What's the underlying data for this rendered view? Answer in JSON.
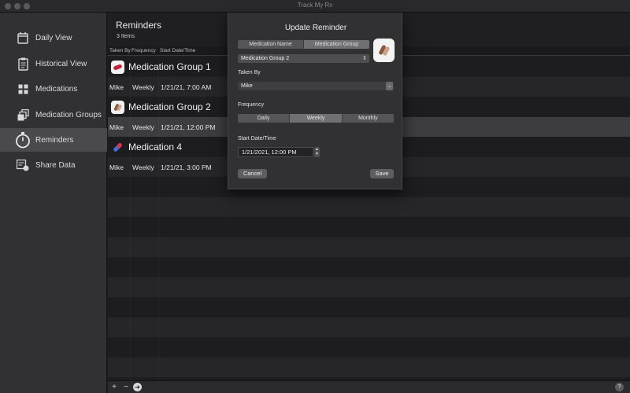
{
  "window": {
    "title": "Track My Rx"
  },
  "sidebar": {
    "items": [
      {
        "label": "Daily View",
        "icon": "calendar-icon"
      },
      {
        "label": "Historical View",
        "icon": "clipboard-icon"
      },
      {
        "label": "Medications",
        "icon": "grid-icon"
      },
      {
        "label": "Medication Groups",
        "icon": "stacked-squares-icon"
      },
      {
        "label": "Reminders",
        "icon": "stopwatch-icon"
      },
      {
        "label": "Share Data",
        "icon": "share-data-icon"
      }
    ],
    "active_index": 4
  },
  "main": {
    "title": "Reminders",
    "count": "3 Items",
    "columns": [
      "Taken By",
      "Frequency",
      "Start Date/Time"
    ],
    "groups": [
      {
        "name": "Medication Group 1",
        "icon": "pill-icon",
        "row": {
          "taken_by": "Mike",
          "frequency": "Weekly",
          "start": "1/21/21, 7:00 AM"
        }
      },
      {
        "name": "Medication Group 2",
        "icon": "capsules-icon",
        "row": {
          "taken_by": "Mike",
          "frequency": "Weekly",
          "start": "1/21/21, 12:00 PM"
        }
      },
      {
        "name": "Medication 4",
        "icon": "capsule-icon",
        "row": {
          "taken_by": "Mike",
          "frequency": "Weekly",
          "start": "1/21/21, 3:00 PM"
        }
      }
    ]
  },
  "bottom_bar": {
    "add": "+",
    "remove": "−",
    "go": "➜",
    "help": "?"
  },
  "sheet": {
    "title": "Update Reminder",
    "source_tabs": [
      "Medication Name",
      "Medication Group"
    ],
    "source_selected": 1,
    "group_value": "Medication Group 2",
    "taken_by_label": "Taken By",
    "taken_by_value": "Mike",
    "frequency_label": "Frequency",
    "frequency_options": [
      "Daily",
      "Weekly",
      "Monthly"
    ],
    "frequency_selected": 1,
    "start_label": "Start Date/Time",
    "start_value": "1/21/2021, 12:00 PM",
    "cancel_label": "Cancel",
    "save_label": "Save"
  },
  "colors": {
    "background": "#1f1f21",
    "sidebar": "#313133",
    "selected_row": "#3d3d40",
    "sheet": "#313133"
  }
}
